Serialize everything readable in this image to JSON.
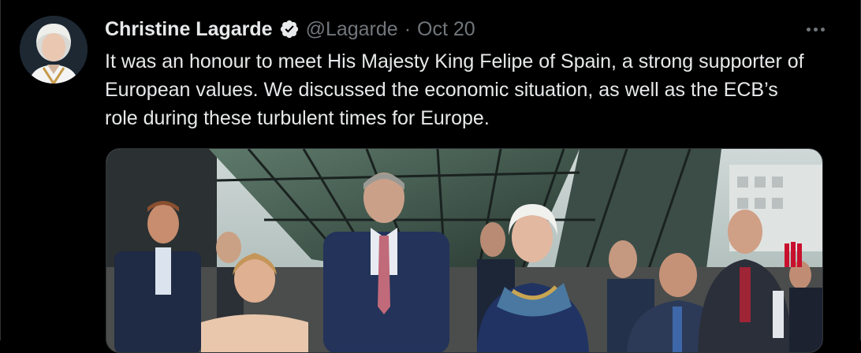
{
  "tweet": {
    "author": {
      "display_name": "Christine Lagarde",
      "handle": "@Lagarde",
      "verified_icon": "verified-badge-icon",
      "avatar_icon": "avatar-portrait"
    },
    "separator": "·",
    "date": "Oct 20",
    "text": "It was an honour to meet His Majesty King Felipe of Spain, a strong supporter of European values. We discussed the economic situation, as well as the ECB’s role during these turbulent times for Europe.",
    "more_icon": "more-options-icon",
    "media_icon": "photo-image"
  },
  "colors": {
    "background": "#000000",
    "text": "#e7e9ea",
    "secondary": "#71767b",
    "border": "#2f3336"
  }
}
